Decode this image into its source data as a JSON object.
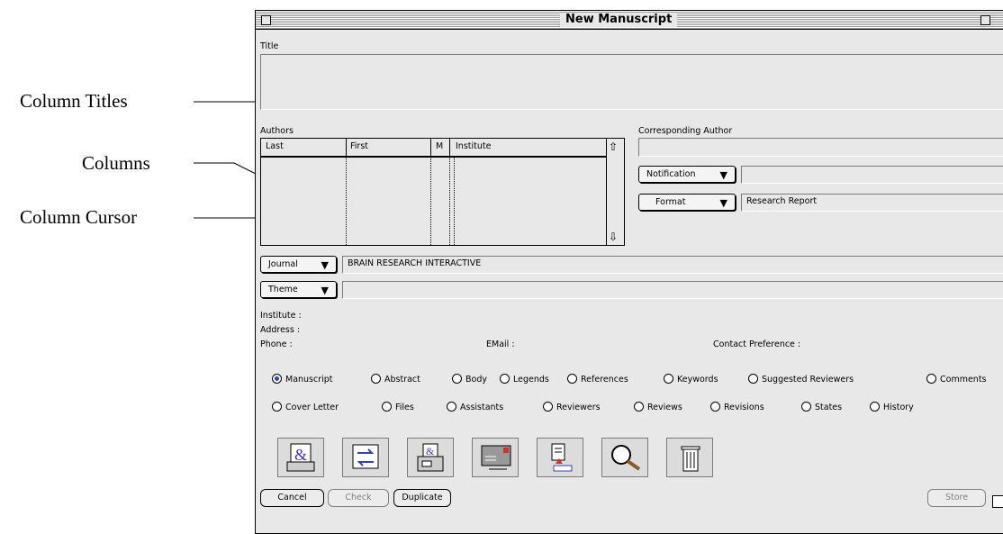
{
  "callouts": {
    "column_titles": "Column Titles",
    "columns": "Columns",
    "column_cursor": "Column Cursor"
  },
  "window": {
    "title": "New Manuscript"
  },
  "title_section": {
    "label": "Title",
    "value": ""
  },
  "authors": {
    "label": "Authors",
    "columns": [
      "Last",
      "First",
      "M",
      "Institute"
    ],
    "rows": []
  },
  "corresponding_author": {
    "label": "Corresponding Author",
    "value": ""
  },
  "notification": {
    "label": "Notification",
    "value": ""
  },
  "format": {
    "label": "Format",
    "value": "Research Report"
  },
  "journal": {
    "label": "Journal",
    "value": "BRAIN RESEARCH INTERACTIVE"
  },
  "theme": {
    "label": "Theme",
    "value": ""
  },
  "info": {
    "institute_label": "Institute :",
    "address_label": "Address :",
    "phone_label": "Phone :",
    "email_label": "EMail :",
    "contact_label": "Contact Preference :"
  },
  "tabs_row1": [
    {
      "label": "Manuscript",
      "selected": true
    },
    {
      "label": "Abstract",
      "selected": false
    },
    {
      "label": "Body",
      "selected": false
    },
    {
      "label": "Legends",
      "selected": false
    },
    {
      "label": "References",
      "selected": false
    },
    {
      "label": "Keywords",
      "selected": false
    },
    {
      "label": "Suggested Reviewers",
      "selected": false
    },
    {
      "label": "Comments",
      "selected": false
    }
  ],
  "tabs_row2": [
    {
      "label": "Cover Letter",
      "selected": false
    },
    {
      "label": "Files",
      "selected": false
    },
    {
      "label": "Assistants",
      "selected": false
    },
    {
      "label": "Reviewers",
      "selected": false
    },
    {
      "label": "Reviews",
      "selected": false
    },
    {
      "label": "Revisions",
      "selected": false
    },
    {
      "label": "States",
      "selected": false
    },
    {
      "label": "History",
      "selected": false
    }
  ],
  "toolbar_icons": [
    "print-ampersand-icon",
    "transfer-icon",
    "fax-icon",
    "mail-icon",
    "export-document-icon",
    "search-magnifier-icon",
    "trash-icon"
  ],
  "buttons": {
    "cancel": "Cancel",
    "check": "Check",
    "duplicate": "Duplicate",
    "store": "Store"
  },
  "colors": {
    "window_bg": "#e8e8e8",
    "radio_accent": "#3344aa"
  }
}
